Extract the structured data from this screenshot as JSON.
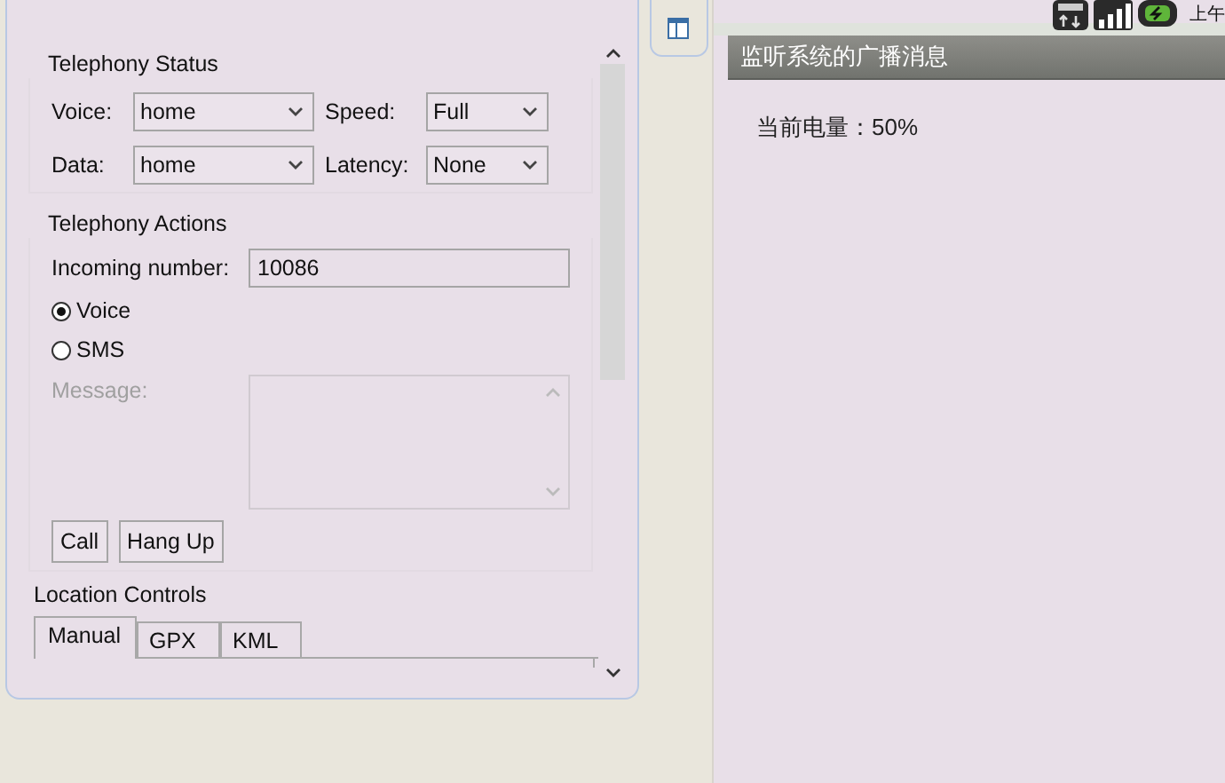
{
  "telephony_status": {
    "title": "Telephony Status",
    "fields": [
      {
        "label": "Voice:",
        "value": "home"
      },
      {
        "label": "Speed:",
        "value": "Full"
      },
      {
        "label": "Data:",
        "value": "home"
      },
      {
        "label": "Latency:",
        "value": "None"
      }
    ]
  },
  "telephony_actions": {
    "title": "Telephony Actions",
    "incoming_label": "Incoming number:",
    "incoming_value": "10086",
    "modes": [
      {
        "label": "Voice",
        "selected": true
      },
      {
        "label": "SMS",
        "selected": false
      }
    ],
    "message_label": "Message:",
    "message_disabled": true,
    "buttons": [
      "Call",
      "Hang Up"
    ]
  },
  "location_controls": {
    "title": "Location Controls",
    "tabs": [
      {
        "label": "Manual",
        "selected": true
      },
      {
        "label": "GPX",
        "selected": false
      },
      {
        "label": "KML",
        "selected": false
      }
    ]
  },
  "device": {
    "status_time": "上午",
    "title": "监听系统的广播消息",
    "message": "当前电量：50%"
  }
}
